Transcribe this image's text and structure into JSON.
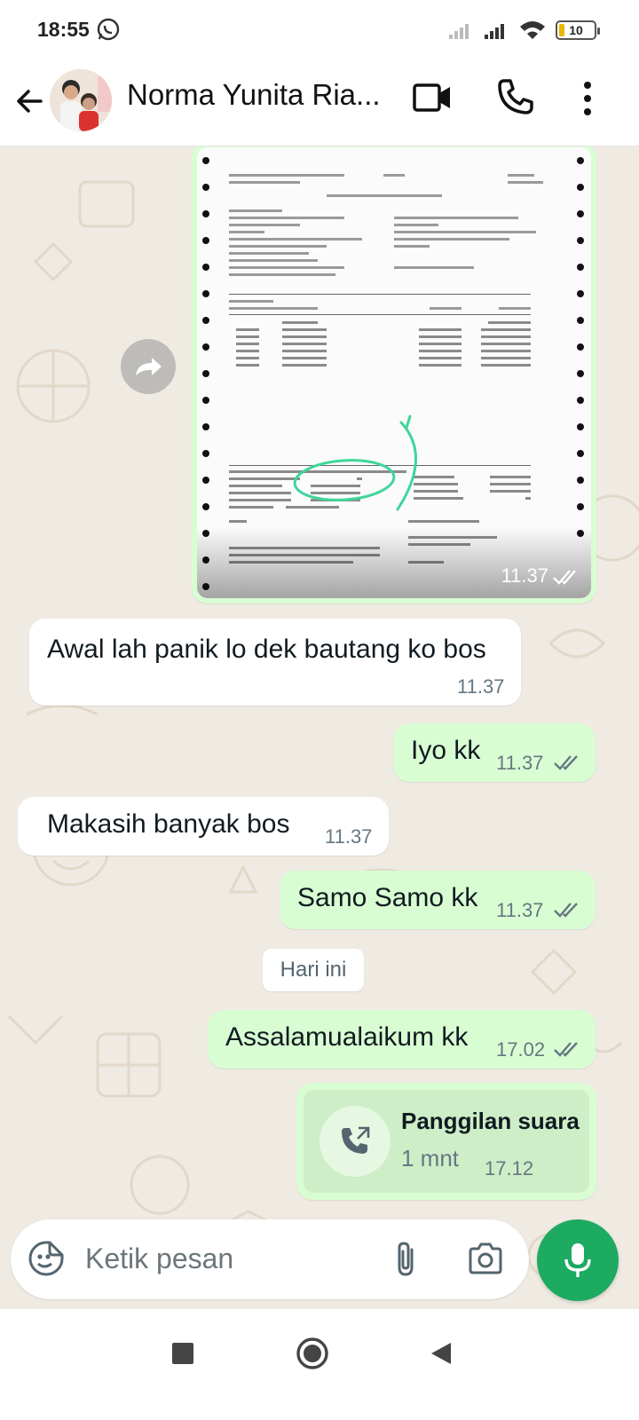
{
  "status_bar": {
    "time": "18:55",
    "battery": "10"
  },
  "header": {
    "contact_name": "Norma Yunita Ria..."
  },
  "document_image": {
    "time": "11.37"
  },
  "messages": [
    {
      "direction": "in",
      "text": "Awal lah panik lo dek bautang ko bos",
      "time": "11.37"
    },
    {
      "direction": "out",
      "text": "Iyo kk",
      "time": "11.37"
    },
    {
      "direction": "in",
      "text": "Makasih banyak bos",
      "time": "11.37"
    },
    {
      "direction": "out",
      "text": "Samo Samo kk",
      "time": "11.37"
    }
  ],
  "date_divider": "Hari ini",
  "messages_today": [
    {
      "direction": "out",
      "text": "Assalamualaikum kk",
      "time": "17.02"
    }
  ],
  "voice_call": {
    "title": "Panggilan suara",
    "duration": "1 mnt",
    "time": "17.12"
  },
  "composer": {
    "placeholder": "Ketik pesan"
  },
  "colors": {
    "outgoing_bubble": "#d9fdd3",
    "incoming_bubble": "#ffffff",
    "mic_button": "#1daa61",
    "chat_background": "#efeae2"
  }
}
